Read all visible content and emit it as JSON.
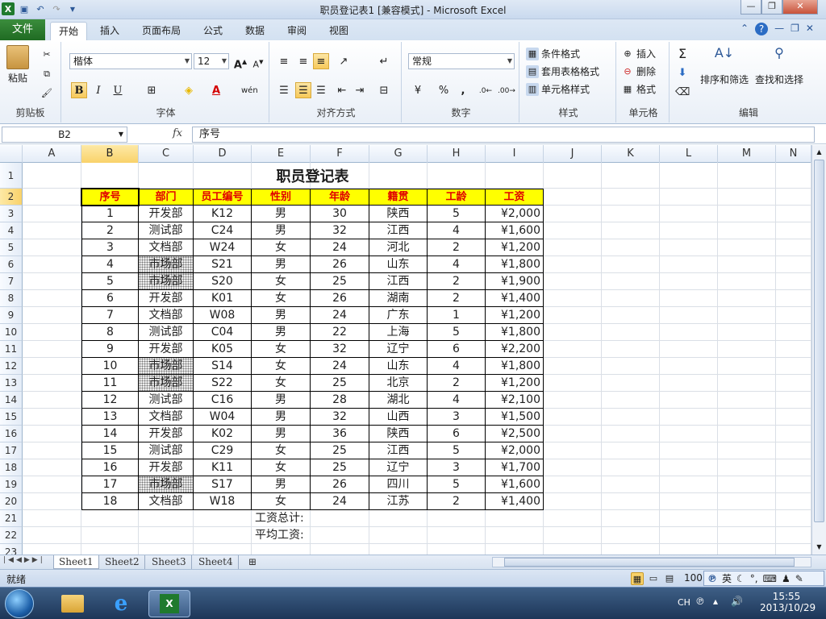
{
  "window": {
    "title": "职员登记表1  [兼容模式]  -  Microsoft Excel"
  },
  "ribbon_tabs": [
    "开始",
    "插入",
    "页面布局",
    "公式",
    "数据",
    "审阅",
    "视图"
  ],
  "file_tab": "文件",
  "clipboard": {
    "paste": "粘贴",
    "group": "剪贴板"
  },
  "font": {
    "name": "楷体",
    "size": "12",
    "group": "字体",
    "bold": "B",
    "italic": "I",
    "underline": "U"
  },
  "alignment": {
    "group": "对齐方式"
  },
  "number": {
    "format": "常规",
    "group": "数字",
    "percent": "%",
    "comma": ","
  },
  "styles": {
    "conditional": "条件格式",
    "table": "套用表格格式",
    "cell": "单元格样式",
    "group": "样式"
  },
  "cells": {
    "insert": "插入",
    "delete": "删除",
    "format": "格式",
    "group": "单元格"
  },
  "editing": {
    "sort": "排序和筛选",
    "find": "查找和选择",
    "group": "编辑"
  },
  "formula_bar": {
    "name_box": "B2",
    "fx": "fx",
    "content": "序号"
  },
  "columns": [
    "A",
    "B",
    "C",
    "D",
    "E",
    "F",
    "G",
    "H",
    "I",
    "J",
    "K",
    "L",
    "M",
    "N"
  ],
  "rows": [
    "1",
    "2",
    "3",
    "4",
    "5",
    "6",
    "7",
    "8",
    "9",
    "10",
    "11",
    "12",
    "13",
    "14",
    "15",
    "16",
    "17",
    "18",
    "19",
    "20",
    "21",
    "22",
    "23"
  ],
  "sheet": {
    "title": "职员登记表",
    "headers": [
      "序号",
      "部门",
      "员工编号",
      "性别",
      "年龄",
      "籍贯",
      "工龄",
      "工资"
    ],
    "data": [
      [
        "1",
        "开发部",
        "K12",
        "男",
        "30",
        "陕西",
        "5",
        "¥2,000"
      ],
      [
        "2",
        "测试部",
        "C24",
        "男",
        "32",
        "江西",
        "4",
        "¥1,600"
      ],
      [
        "3",
        "文档部",
        "W24",
        "女",
        "24",
        "河北",
        "2",
        "¥1,200"
      ],
      [
        "4",
        "市场部",
        "S21",
        "男",
        "26",
        "山东",
        "4",
        "¥1,800"
      ],
      [
        "5",
        "市场部",
        "S20",
        "女",
        "25",
        "江西",
        "2",
        "¥1,900"
      ],
      [
        "6",
        "开发部",
        "K01",
        "女",
        "26",
        "湖南",
        "2",
        "¥1,400"
      ],
      [
        "7",
        "文档部",
        "W08",
        "男",
        "24",
        "广东",
        "1",
        "¥1,200"
      ],
      [
        "8",
        "测试部",
        "C04",
        "男",
        "22",
        "上海",
        "5",
        "¥1,800"
      ],
      [
        "9",
        "开发部",
        "K05",
        "女",
        "32",
        "辽宁",
        "6",
        "¥2,200"
      ],
      [
        "10",
        "市场部",
        "S14",
        "女",
        "24",
        "山东",
        "4",
        "¥1,800"
      ],
      [
        "11",
        "市场部",
        "S22",
        "女",
        "25",
        "北京",
        "2",
        "¥1,200"
      ],
      [
        "12",
        "测试部",
        "C16",
        "男",
        "28",
        "湖北",
        "4",
        "¥2,100"
      ],
      [
        "13",
        "文档部",
        "W04",
        "男",
        "32",
        "山西",
        "3",
        "¥1,500"
      ],
      [
        "14",
        "开发部",
        "K02",
        "男",
        "36",
        "陕西",
        "6",
        "¥2,500"
      ],
      [
        "15",
        "测试部",
        "C29",
        "女",
        "25",
        "江西",
        "5",
        "¥2,000"
      ],
      [
        "16",
        "开发部",
        "K11",
        "女",
        "25",
        "辽宁",
        "3",
        "¥1,700"
      ],
      [
        "17",
        "市场部",
        "S17",
        "男",
        "26",
        "四川",
        "5",
        "¥1,600"
      ],
      [
        "18",
        "文档部",
        "W18",
        "女",
        "24",
        "江苏",
        "2",
        "¥1,400"
      ]
    ],
    "footer_total": "工资总计:",
    "footer_avg": "平均工资:"
  },
  "sheet_tabs": [
    "Sheet1",
    "Sheet2",
    "Sheet3",
    "Sheet4"
  ],
  "status": {
    "ready": "就绪",
    "zoom": "100",
    "ime": "英"
  },
  "taskbar": {
    "lang": "CH",
    "time": "15:55",
    "date": "2013/10/29"
  },
  "colors": {
    "header_fill": "#ffff00",
    "header_text": "#e00000",
    "file_tab": "#2a7a2e"
  }
}
